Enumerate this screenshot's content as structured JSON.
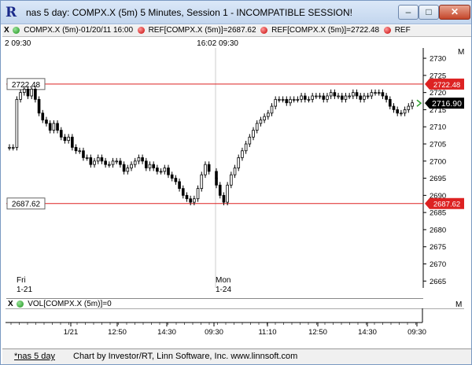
{
  "window": {
    "app_icon": "R",
    "title": "nas 5 day: COMPX.X (5m) 5 Minutes, Session 1 - INCOMPATIBLE SESSION!",
    "minimize_label": "–",
    "maximize_label": "□",
    "close_label": "✕"
  },
  "indicators": {
    "close_x": "X",
    "main_series": "COMPX.X (5m)-01/20/11 16:00",
    "ref1": "REF[COMPX.X (5m)]=2687.62",
    "ref2": "REF[COMPX.X (5m)]=2722.48",
    "ref3": "REF",
    "menu_label": "M"
  },
  "time_row": {
    "left_fragment": "2  09:30",
    "mid": "16:02  09:30"
  },
  "volume": {
    "close_x": "X",
    "label": "VOL[COMPX.X (5m)]=0",
    "menu_label": "M"
  },
  "footer": {
    "tab": "*nas 5 day",
    "credit": "Chart by Investor/RT, Linn Software, Inc. www.linnsoft.com"
  },
  "colors": {
    "ref_line": "#dd2222",
    "last_price_box": "#000000",
    "bar": "#000000"
  },
  "chart_data": {
    "type": "candlestick",
    "y_ticks": [
      "2730",
      "2725",
      "2720",
      "2715",
      "2710",
      "2705",
      "2700",
      "2695",
      "2690",
      "2685",
      "2680",
      "2675",
      "2670",
      "2665"
    ],
    "ylim": [
      2663,
      2733
    ],
    "ref_lines": [
      {
        "value": 2722.48,
        "label": "2722.48"
      },
      {
        "value": 2687.62,
        "label": "2687.62"
      }
    ],
    "last_price": {
      "value": 2716.9,
      "label": "2716.90"
    },
    "day_labels": [
      {
        "day": "Fri",
        "date": "1-21"
      },
      {
        "day": "Mon",
        "date": "1-24"
      }
    ],
    "x_ticks": [
      "1/21",
      "12:50",
      "14:30",
      "09:30",
      "11:10",
      "12:50",
      "14:30",
      "09:30"
    ],
    "closes": [
      2704,
      2704,
      2718,
      2720,
      2721,
      2719,
      2721,
      2718,
      2714,
      2712,
      2711,
      2709,
      2711,
      2709,
      2707,
      2706,
      2707,
      2704,
      2703,
      2703,
      2701,
      2701,
      2699,
      2700,
      2701,
      2700,
      2699,
      2699,
      2700,
      2700,
      2699,
      2697,
      2698,
      2699,
      2700,
      2701,
      2700,
      2698,
      2699,
      2698,
      2697,
      2697,
      2698,
      2696,
      2695,
      2694,
      2692,
      2690,
      2689,
      2688,
      2689,
      2692,
      2696,
      2699,
      2697,
      2695,
      2693,
      2690,
      2688,
      2693,
      2696,
      2698,
      2701,
      2703,
      2705,
      2707,
      2709,
      2711,
      2712,
      2713,
      2714,
      2716,
      2718,
      2718,
      2718,
      2717,
      2718,
      2718,
      2718,
      2719,
      2718,
      2718,
      2719,
      2719,
      2719,
      2718,
      2719,
      2720,
      2719,
      2719,
      2718,
      2719,
      2719,
      2720,
      2719,
      2718,
      2719,
      2719,
      2720,
      2720,
      2720,
      2719,
      2718,
      2716,
      2715,
      2714,
      2714,
      2715,
      2716,
      2717
    ]
  }
}
